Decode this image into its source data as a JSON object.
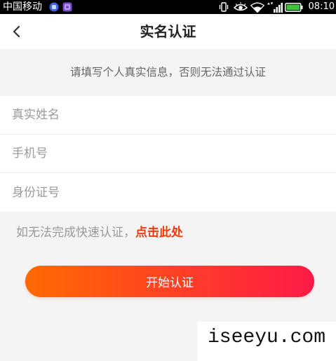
{
  "status_bar": {
    "carrier": "中国移动",
    "time": "08:10",
    "notification_icons": [
      "app-notification-icon",
      "app-notification-icon"
    ],
    "system_icons": [
      "vibrate-icon",
      "eye-icon",
      "wifi-icon",
      "signal-icon",
      "battery-icon"
    ]
  },
  "header": {
    "title": "实名认证",
    "back_icon": "chevron-left-icon"
  },
  "notice": {
    "text": "请填写个人真实信息，否则无法通过认证"
  },
  "form": {
    "fields": [
      {
        "placeholder": "真实姓名"
      },
      {
        "placeholder": "手机号"
      },
      {
        "placeholder": "身份证号"
      }
    ]
  },
  "help": {
    "text": "如无法完成快速认证，",
    "link_label": "点击此处"
  },
  "submit_button": {
    "label": "开始认证"
  },
  "watermark": {
    "text": "iseeyu.com"
  },
  "colors": {
    "status_bar_bg": "#000000",
    "page_bg": "#f4f4f4",
    "link": "#f2380f",
    "button_gradient_start": "#ff6a00",
    "button_gradient_end": "#ff1a47",
    "battery": "#3cc23c"
  }
}
